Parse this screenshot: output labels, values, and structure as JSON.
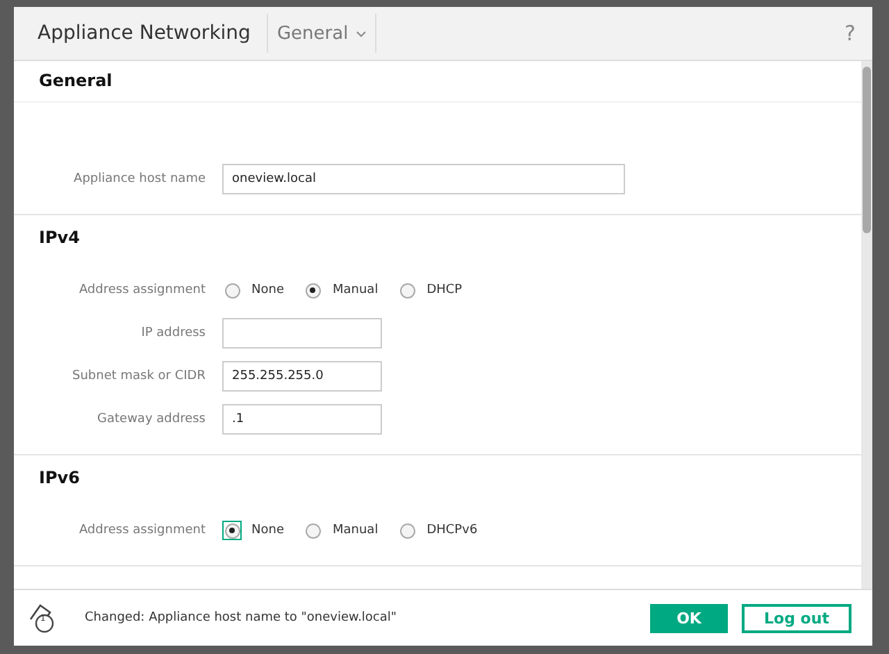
{
  "dialog": {
    "title": "Appliance Networking",
    "view_selector": "General",
    "help": "?"
  },
  "sections": [
    {
      "title": "General",
      "rows": [
        {
          "kind": "text",
          "label": "Appliance host name",
          "value": "oneview.local"
        }
      ]
    },
    {
      "title": "IPv4",
      "rows": [
        {
          "kind": "radio",
          "label": "Address assignment",
          "options": [
            {
              "label": "None",
              "selected": false,
              "focused": false
            },
            {
              "label": "Manual",
              "selected": true,
              "focused": false
            },
            {
              "label": "DHCP",
              "selected": false,
              "focused": false
            }
          ]
        },
        {
          "kind": "text",
          "label": "IP address",
          "value": ""
        },
        {
          "kind": "text",
          "label": "Subnet mask or CIDR",
          "value": "255.255.255.0"
        },
        {
          "kind": "text",
          "label": "Gateway address",
          "value": ".1"
        }
      ]
    },
    {
      "title": "IPv6",
      "rows": [
        {
          "kind": "radio",
          "label": "Address assignment",
          "options": [
            {
              "label": "None",
              "selected": true,
              "focused": true
            },
            {
              "label": "Manual",
              "selected": false,
              "focused": false
            },
            {
              "label": "DHCPv6",
              "selected": false,
              "focused": false
            }
          ]
        }
      ]
    }
  ],
  "footer": {
    "change_count": "1",
    "message": "Changed: Appliance host name to \"oneview.local\"",
    "buttons": [
      {
        "label": "OK",
        "kind": "primary"
      },
      {
        "label": "Log out",
        "kind": "secondary"
      }
    ]
  }
}
